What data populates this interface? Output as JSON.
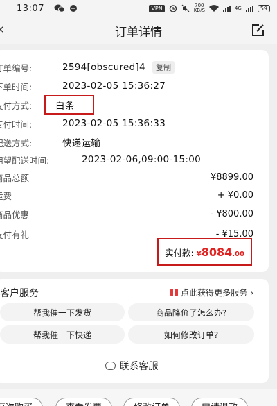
{
  "status_bar": {
    "time": "13:07",
    "vpn": "VPN",
    "speed_value": "700",
    "speed_unit": "KB/S",
    "network": "4G",
    "battery": "59"
  },
  "header": {
    "title": "订单详情"
  },
  "order": {
    "rows": [
      {
        "label": "订单编号:",
        "value": "2594[obscured]4",
        "copy": "复制"
      },
      {
        "label": "下单时间:",
        "value": "2023-02-05 15:36:27"
      },
      {
        "label": "支付方式:",
        "value": "白条"
      },
      {
        "label": "支付时间:",
        "value": "2023-02-05 15:36:33"
      },
      {
        "label": "配送方式:",
        "value": "快递运输"
      },
      {
        "label": "期望配送时间:",
        "value": "2023-02-06,09:00-15:00"
      }
    ],
    "amounts": [
      {
        "label": "商品总额",
        "value": "¥8899.00"
      },
      {
        "label": "运费",
        "value": "+ ¥0.00"
      },
      {
        "label": "商品优惠",
        "value": "- ¥800.00"
      },
      {
        "label": "支付有礼",
        "value": "- ¥15.00"
      }
    ],
    "paid_label": "实付款:",
    "paid_symbol": "¥",
    "paid_int": "8084",
    "paid_dec": ".00"
  },
  "service": {
    "title": "客户服务",
    "more": "点此获得更多服务",
    "faqs": [
      "帮我催一下发货",
      "商品降价了怎么办?",
      "帮我催一下快递",
      "如何修改订单?"
    ],
    "contact": "联系客服"
  },
  "bottom_buttons": [
    "再次购买",
    "查看发票",
    "修改订单",
    "申请退款"
  ],
  "colors": {
    "accent_red": "#e0201e",
    "highlight_border": "#c71a1a"
  }
}
